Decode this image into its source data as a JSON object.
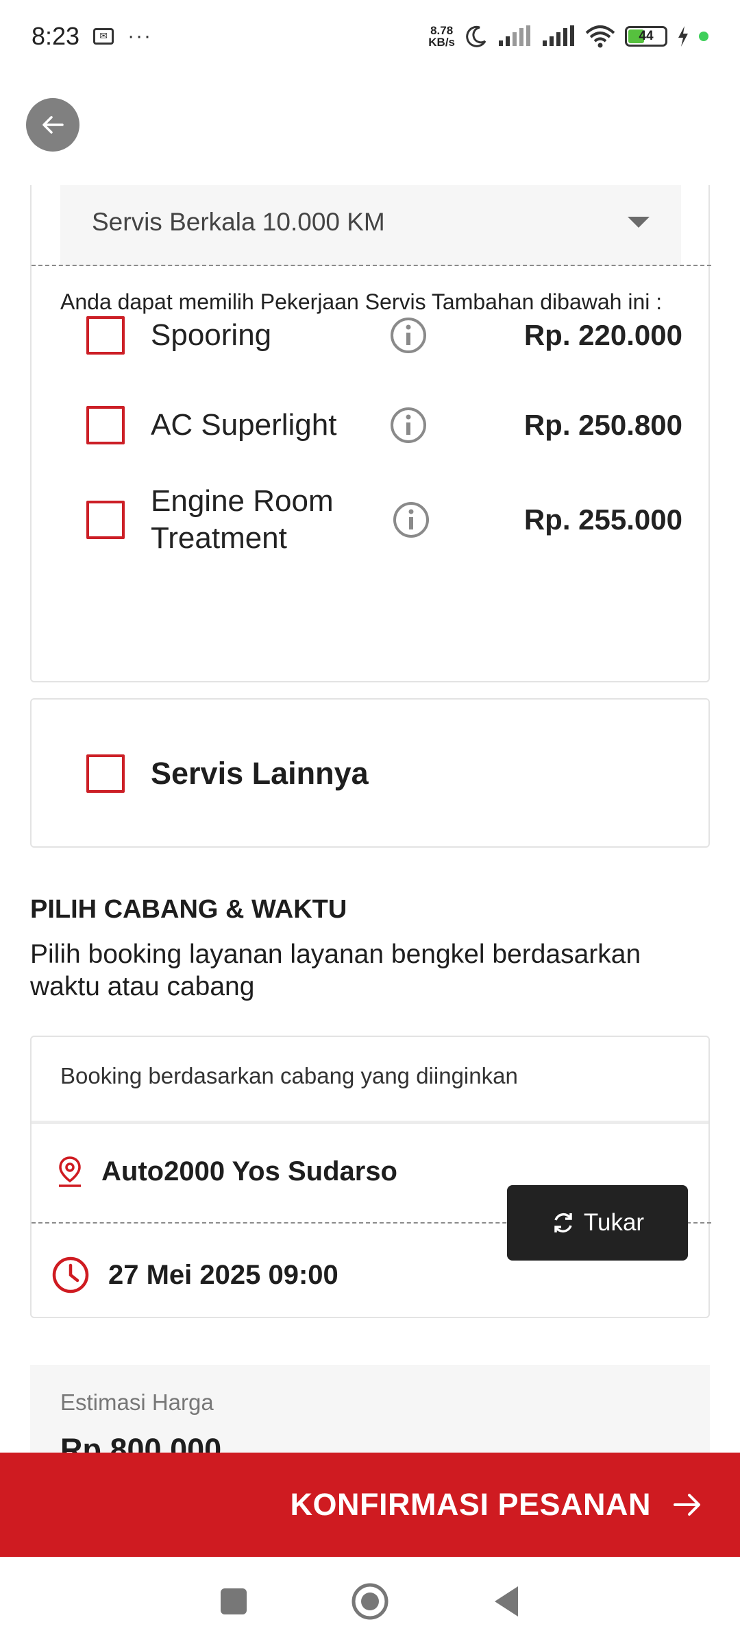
{
  "status_bar": {
    "time": "8:23",
    "dots": "···",
    "net_speed_value": "8.78",
    "net_speed_unit": "KB/s",
    "battery": "44",
    "battery_level": 0.44
  },
  "package": {
    "selected": "Servis Berkala 10.000 KM",
    "intro": "Anda dapat memilih Pekerjaan Servis Tambahan dibawah ini :",
    "extras": [
      {
        "name": "Spooring",
        "price": "Rp. 220.000",
        "checked": false
      },
      {
        "name": "AC Superlight",
        "price": "Rp. 250.800",
        "checked": false
      },
      {
        "name": "Engine Room Treatment",
        "price": "Rp. 255.000",
        "checked": false
      }
    ]
  },
  "other_service": {
    "label": "Servis Lainnya",
    "checked": false
  },
  "branch_time": {
    "title": "PILIH CABANG & WAKTU",
    "description": "Pilih booking layanan layanan bengkel berdasarkan waktu atau cabang",
    "booking_mode": "Booking berdasarkan cabang yang diinginkan",
    "branch": "Auto2000 Yos Sudarso",
    "datetime": "27 Mei 2025 09:00",
    "swap_label": "Tukar"
  },
  "estimate": {
    "label": "Estimasi Harga",
    "value": "Rp 800.000"
  },
  "confirm": {
    "label": "KONFIRMASI PESANAN"
  },
  "colors": {
    "accent_red": "#cf1b21",
    "dark_button": "#222222",
    "panel_gray": "#f6f6f6"
  }
}
